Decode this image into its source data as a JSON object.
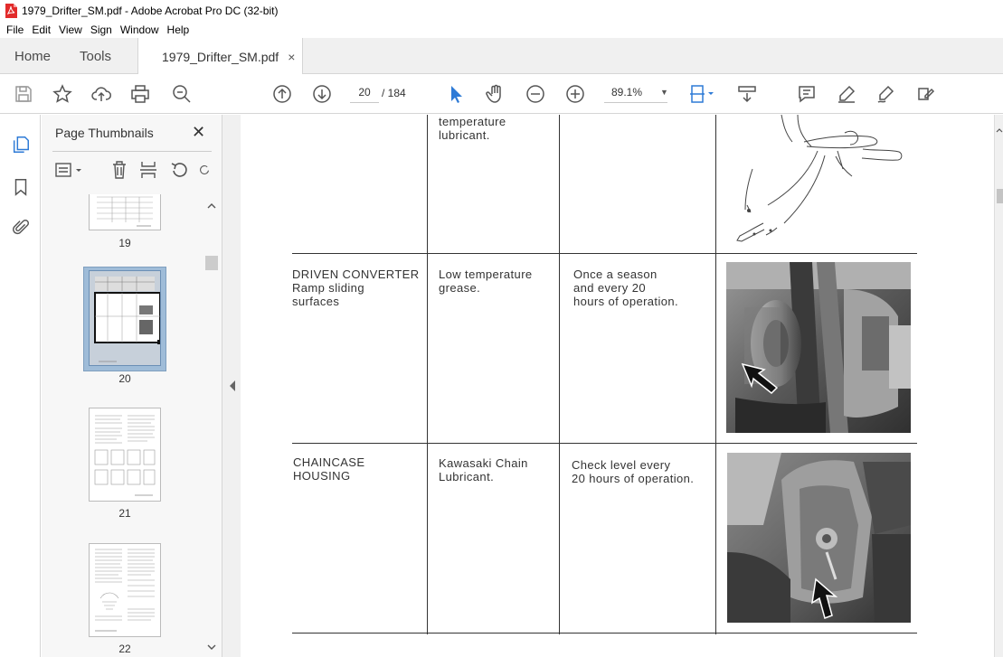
{
  "window": {
    "title": "1979_Drifter_SM.pdf - Adobe Acrobat Pro DC (32-bit)"
  },
  "menu": [
    "File",
    "Edit",
    "View",
    "Sign",
    "Window",
    "Help"
  ],
  "tabs": {
    "home": "Home",
    "tools": "Tools",
    "document": "1979_Drifter_SM.pdf",
    "close": "×"
  },
  "toolbar": {
    "page_current": "20",
    "page_total": "/  184",
    "zoom": "89.1%"
  },
  "panel": {
    "title": "Page Thumbnails",
    "close": "✕",
    "thumbnails": [
      {
        "label": "19"
      },
      {
        "label": "20",
        "selected": true
      },
      {
        "label": "21"
      },
      {
        "label": "22"
      }
    ]
  },
  "document": {
    "rows": [
      {
        "item": "",
        "lubricant": "temperature\nlubricant.",
        "interval": ""
      },
      {
        "item": "DRIVEN CONVERTER\nRamp sliding\nsurfaces",
        "lubricant": "Low temperature\ngrease.",
        "interval": "Once a season\nand every 20\nhours of operation."
      },
      {
        "item": "CHAINCASE\nHOUSING",
        "lubricant": "Kawasaki Chain\nLubricant.",
        "interval": "Check level every\n20 hours of operation."
      }
    ]
  },
  "colors": {
    "accent_blue": "#2d7ad6",
    "tab_bg": "#f0f0f0",
    "selection": "#9fbcd8"
  }
}
